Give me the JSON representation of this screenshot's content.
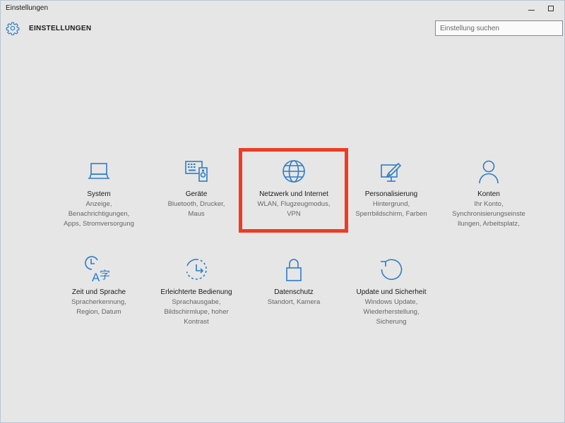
{
  "window": {
    "title": "Einstellungen"
  },
  "header": {
    "title": "EINSTELLUNGEN",
    "search_placeholder": "Einstellung suchen"
  },
  "accent_color": "#2d7cc9",
  "highlight_color": "#ef3b24",
  "tiles": [
    {
      "name": "System",
      "desc": [
        "Anzeige,",
        "Benachrichtigungen,",
        "Apps, Stromversorgung"
      ],
      "icon": "laptop-icon"
    },
    {
      "name": "Geräte",
      "desc": [
        "Bluetooth, Drucker,",
        "Maus"
      ],
      "icon": "devices-icon"
    },
    {
      "name": "Netzwerk und Internet",
      "desc": [
        "WLAN, Flugzeugmodus,",
        "VPN"
      ],
      "icon": "globe-icon"
    },
    {
      "name": "Personalisierung",
      "desc": [
        "Hintergrund,",
        "Sperrbildschirm, Farben"
      ],
      "icon": "paint-icon"
    },
    {
      "name": "Konten",
      "desc": [
        "Ihr Konto,",
        "Synchronisierungseinste",
        "llungen, Arbeitsplatz,"
      ],
      "icon": "person-icon"
    },
    {
      "name": "Zeit und Sprache",
      "desc": [
        "Spracherkennung,",
        "Region, Datum"
      ],
      "icon": "time-language-icon"
    },
    {
      "name": "Erleichterte Bedienung",
      "desc": [
        "Sprachausgabe,",
        "Bildschirmlupe, hoher",
        "Kontrast"
      ],
      "icon": "accessibility-icon"
    },
    {
      "name": "Datenschutz",
      "desc": [
        "Standort, Kamera"
      ],
      "icon": "lock-icon"
    },
    {
      "name": "Update und Sicherheit",
      "desc": [
        "Windows Update,",
        "Wiederherstellung,",
        "Sicherung"
      ],
      "icon": "update-icon"
    }
  ]
}
